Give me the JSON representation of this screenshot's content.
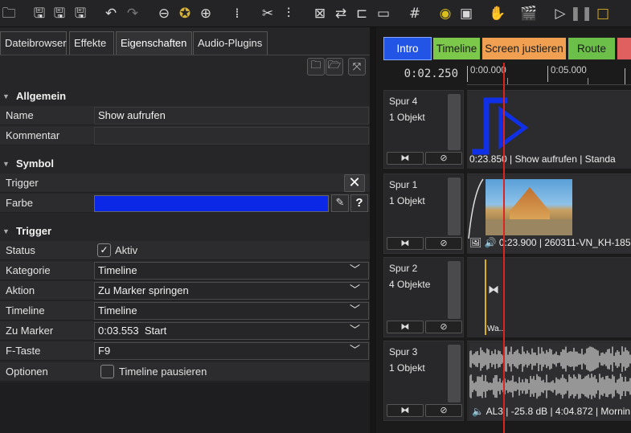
{
  "toolbar": {
    "icons": [
      "open-folder-icon",
      "save-icon",
      "save-as-icon",
      "save-plus-icon",
      "undo-icon",
      "redo-icon",
      "zoom-out-icon",
      "star-icon",
      "zoom-in-icon",
      "align-icon",
      "cut-icon",
      "split-icon",
      "remove-gap-icon",
      "swap-icon",
      "snap-icon",
      "ruler-icon",
      "grid-icon",
      "eye-icon",
      "image-frame-icon",
      "hand-icon",
      "clapper-icon",
      "play-icon",
      "pause-icon",
      "stop-icon"
    ]
  },
  "left": {
    "tabs": [
      {
        "label": "Dateibrowser"
      },
      {
        "label": "Effekte"
      },
      {
        "label": "Eigenschaften"
      },
      {
        "label": "Audio-Plugins"
      }
    ],
    "sections": {
      "allgemein": "Allgemein",
      "symbol": "Symbol",
      "trigger": "Trigger"
    },
    "general": {
      "name_label": "Name",
      "name_value": "Show aufrufen",
      "comment_label": "Kommentar",
      "comment_value": ""
    },
    "symbol": {
      "trigger_label": "Trigger",
      "color_label": "Farbe",
      "color_value": "#0a28e6"
    },
    "trigger": {
      "status_label": "Status",
      "status_value": "Aktiv",
      "status_checked": true,
      "rows": [
        {
          "label": "Kategorie",
          "value": "Timeline"
        },
        {
          "label": "Aktion",
          "value": "Zu Marker springen"
        },
        {
          "label": "Timeline",
          "value": "Timeline"
        },
        {
          "label": "Zu Marker",
          "value": "0:03.553  Start"
        },
        {
          "label": "F-Taste",
          "value": "F9"
        }
      ],
      "options_label": "Optionen",
      "options_value": "Timeline pausieren",
      "options_checked": false
    }
  },
  "right": {
    "marker_tabs": [
      {
        "label": "Intro",
        "color": "#2255e6"
      },
      {
        "label": "Timeline",
        "color": "#7cc84a"
      },
      {
        "label": "Screen justieren",
        "color": "#f0a050"
      },
      {
        "label": "Route",
        "color": "#6cc04a"
      },
      {
        "label": "",
        "color": "#e06060"
      }
    ],
    "time_display": "0:02.250",
    "ruler_ticks": [
      "0:00.000",
      "0:05.000"
    ],
    "tracks": [
      {
        "name": "Spur 4",
        "count": "1 Objekt",
        "caption": "0:23.850 | Show aufrufen | Standa"
      },
      {
        "name": "Spur 1",
        "count": "1 Objekt",
        "caption": "0:23.900 | 260311-VN_KH-185"
      },
      {
        "name": "Spur 2",
        "count": "4 Objekte",
        "caption": "Wa..."
      },
      {
        "name": "Spur 3",
        "count": "1 Objekt",
        "caption": "AL3 | -25.8 dB | 4:04.872 | Mornin"
      }
    ]
  }
}
